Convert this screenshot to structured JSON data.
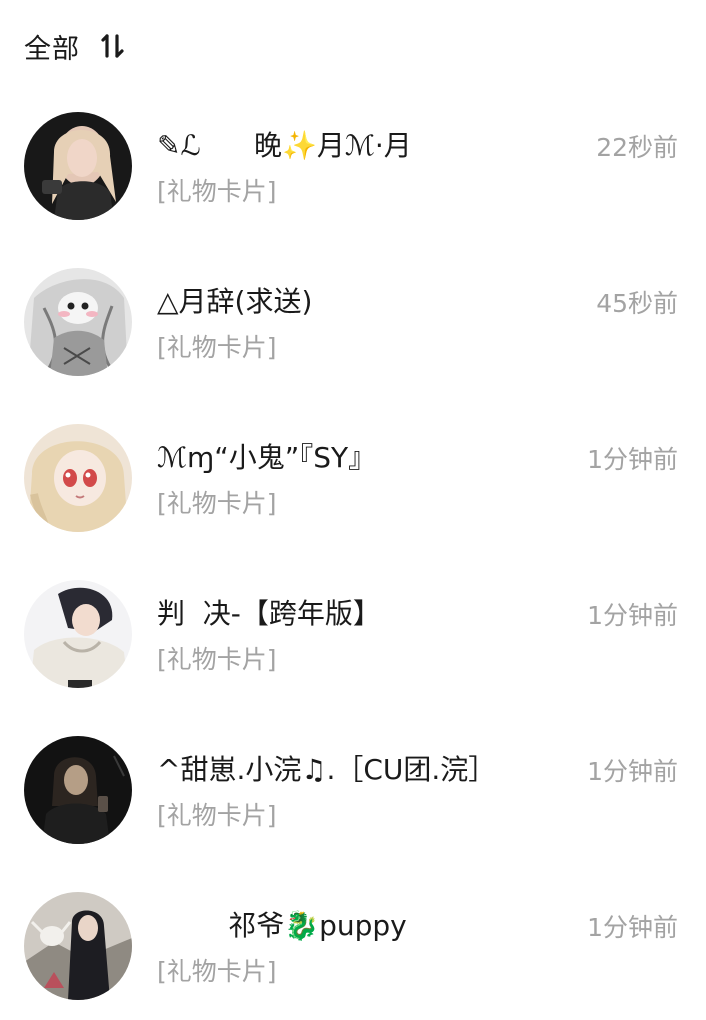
{
  "header": {
    "title": "全部",
    "sort_icon": "sort-toggle-icon"
  },
  "conversations": [
    {
      "name": "✎ℒ      晚✨月ℳ·月",
      "preview": "[礼物卡片]",
      "time": "22秒前",
      "avatar_icon": "user-avatar-photo",
      "avatar_colors": [
        "#1c1c1c",
        "#e9cfc2"
      ]
    },
    {
      "name": "△月辞(求送)",
      "preview": "[礼物卡片]",
      "time": "45秒前",
      "avatar_icon": "user-avatar-illustration",
      "avatar_colors": [
        "#d8d8d8",
        "#f6c7cf"
      ]
    },
    {
      "name": "ℳɱ“小鬼”『SY』",
      "preview": "[礼物卡片]",
      "time": "1分钟前",
      "avatar_icon": "user-avatar-doll",
      "avatar_colors": [
        "#f1e2c9",
        "#d24a4a"
      ]
    },
    {
      "name": "判  决-【跨年版】",
      "preview": "[礼物卡片]",
      "time": "1分钟前",
      "avatar_icon": "user-avatar-photo",
      "avatar_colors": [
        "#f1f1f3",
        "#2a2a33"
      ]
    },
    {
      "name": "^甜崽.小浣♫.［CU团.浣］",
      "preview": "[礼物卡片]",
      "time": "1分钟前",
      "avatar_icon": "user-avatar-photo",
      "avatar_colors": [
        "#141414",
        "#b59e86"
      ]
    },
    {
      "name": "        祁爷🐉puppy",
      "preview": "[礼物卡片]",
      "time": "1分钟前",
      "avatar_icon": "user-avatar-photo",
      "avatar_colors": [
        "#c9c4bd",
        "#1d1d22"
      ]
    }
  ]
}
